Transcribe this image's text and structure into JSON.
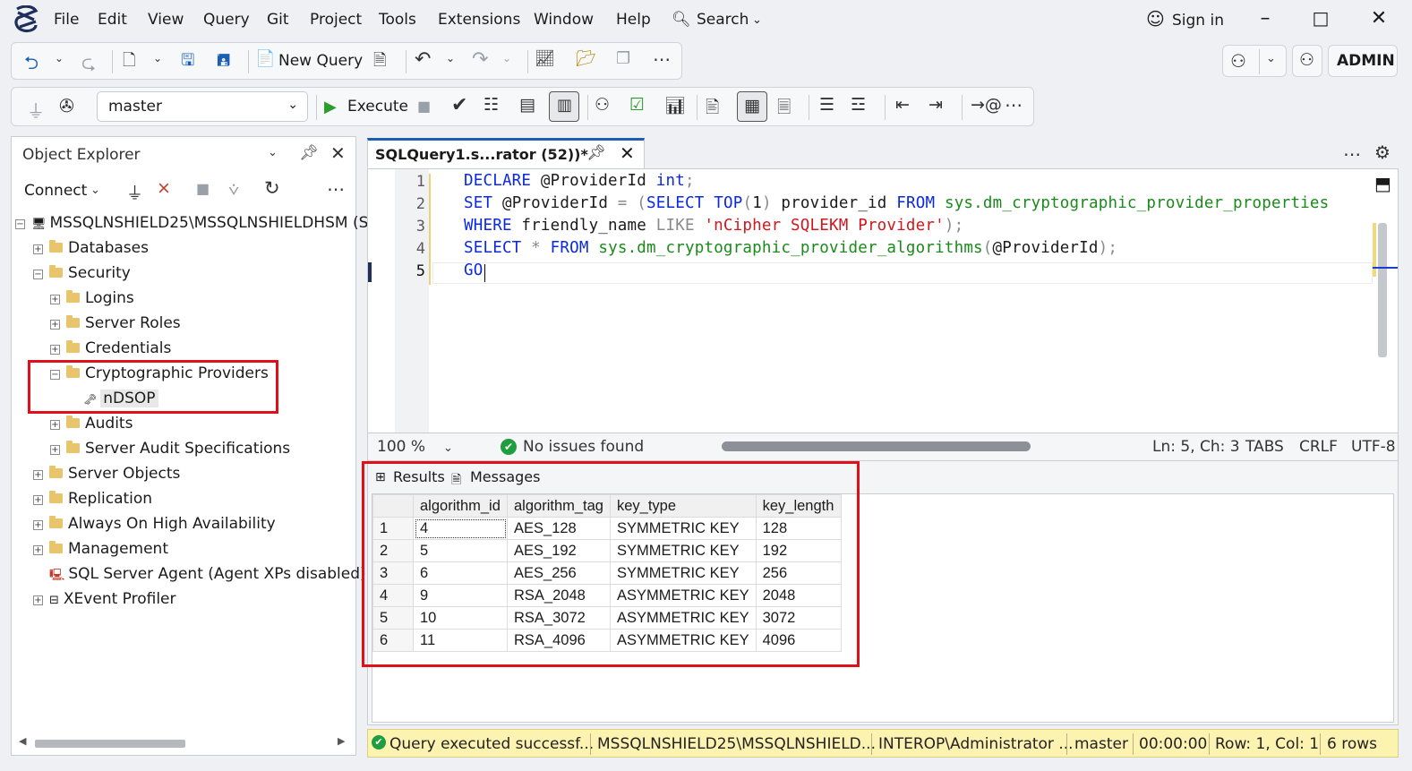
{
  "menu": {
    "items": [
      "File",
      "Edit",
      "View",
      "Query",
      "Git",
      "Project",
      "Tools",
      "Extensions",
      "Window",
      "Help"
    ],
    "search_label": "Search",
    "sign_in": "Sign in",
    "user": "ADMIN"
  },
  "toolbar": {
    "new_query": "New Query",
    "database": "master",
    "execute": "Execute"
  },
  "object_explorer": {
    "title": "Object Explorer",
    "connect": "Connect",
    "tree": [
      {
        "label": "MSSQLNSHIELD25\\MSSQLNSHIELDHSM (S",
        "expander": "−"
      },
      {
        "label": "Databases",
        "expander": "+"
      },
      {
        "label": "Security",
        "expander": "−"
      },
      {
        "label": "Logins",
        "expander": "+"
      },
      {
        "label": "Server Roles",
        "expander": "+"
      },
      {
        "label": "Credentials",
        "expander": "+"
      },
      {
        "label": "Cryptographic Providers",
        "expander": "−"
      },
      {
        "label": "nDSOP",
        "expander": ""
      },
      {
        "label": "Audits",
        "expander": "+"
      },
      {
        "label": "Server Audit Specifications",
        "expander": "+"
      },
      {
        "label": "Server Objects",
        "expander": "+"
      },
      {
        "label": "Replication",
        "expander": "+"
      },
      {
        "label": "Always On High Availability",
        "expander": "+"
      },
      {
        "label": "Management",
        "expander": "+"
      },
      {
        "label": "SQL Server Agent (Agent XPs disabled)",
        "expander": ""
      },
      {
        "label": "XEvent Profiler",
        "expander": "+"
      }
    ]
  },
  "editor": {
    "tab_title": "SQLQuery1.s...rator (52))*",
    "line_numbers": [
      "1",
      "2",
      "3",
      "4",
      "5"
    ],
    "lines": [
      [
        {
          "t": "DECLARE",
          "c": "kw"
        },
        {
          "t": " @ProviderId ",
          "c": ""
        },
        {
          "t": "int",
          "c": "kw"
        },
        {
          "t": ";",
          "c": "gry"
        }
      ],
      [
        {
          "t": "SET",
          "c": "kw"
        },
        {
          "t": " @ProviderId ",
          "c": ""
        },
        {
          "t": "=",
          "c": "gry"
        },
        {
          "t": " ",
          "c": ""
        },
        {
          "t": "(",
          "c": "gry"
        },
        {
          "t": "SELECT",
          "c": "kw"
        },
        {
          "t": " ",
          "c": ""
        },
        {
          "t": "TOP",
          "c": "kw"
        },
        {
          "t": "(",
          "c": "gry"
        },
        {
          "t": "1",
          "c": ""
        },
        {
          "t": ")",
          "c": "gry"
        },
        {
          "t": " provider_id ",
          "c": ""
        },
        {
          "t": "FROM",
          "c": "kw"
        },
        {
          "t": " sys.dm_cryptographic_provider_properties",
          "c": "sys"
        }
      ],
      [
        {
          "t": "WHERE",
          "c": "kw"
        },
        {
          "t": " friendly_name ",
          "c": ""
        },
        {
          "t": "LIKE",
          "c": "gry"
        },
        {
          "t": " ",
          "c": ""
        },
        {
          "t": "'nCipher SQLEKM Provider'",
          "c": "str"
        },
        {
          "t": ")",
          "c": "gry"
        },
        {
          "t": ";",
          "c": "gry"
        }
      ],
      [
        {
          "t": "SELECT",
          "c": "kw"
        },
        {
          "t": " ",
          "c": ""
        },
        {
          "t": "*",
          "c": "gry"
        },
        {
          "t": " ",
          "c": ""
        },
        {
          "t": "FROM",
          "c": "kw"
        },
        {
          "t": " sys.dm_cryptographic_provider_algorithms",
          "c": "sys"
        },
        {
          "t": "(",
          "c": "gry"
        },
        {
          "t": "@ProviderId",
          "c": ""
        },
        {
          "t": ")",
          "c": "gry"
        },
        {
          "t": ";",
          "c": "gry"
        }
      ],
      [
        {
          "t": "GO",
          "c": "kw"
        }
      ]
    ],
    "zoom": "100 %",
    "issues": "No issues found",
    "position": "Ln: 5, Ch: 3",
    "indent": "TABS",
    "line_ending": "CRLF",
    "encoding": "UTF-8"
  },
  "results": {
    "tabs": [
      "Results",
      "Messages"
    ],
    "columns": [
      "algorithm_id",
      "algorithm_tag",
      "key_type",
      "key_length"
    ],
    "rows": [
      [
        "1",
        "4",
        "AES_128",
        "SYMMETRIC KEY",
        "128"
      ],
      [
        "2",
        "5",
        "AES_192",
        "SYMMETRIC KEY",
        "192"
      ],
      [
        "3",
        "6",
        "AES_256",
        "SYMMETRIC KEY",
        "256"
      ],
      [
        "4",
        "9",
        "RSA_2048",
        "ASYMMETRIC KEY",
        "2048"
      ],
      [
        "5",
        "10",
        "RSA_3072",
        "ASYMMETRIC KEY",
        "3072"
      ],
      [
        "6",
        "11",
        "RSA_4096",
        "ASYMMETRIC KEY",
        "4096"
      ]
    ]
  },
  "status_bar": {
    "message": "Query  executed  successf...",
    "server": "MSSQLNSHIELD25\\MSSQLNSHIELD...",
    "user": "INTEROP\\Administrator ...",
    "database": "master",
    "elapsed": "00:00:00",
    "cursor": "Row: 1, Col: 1",
    "rows": "6 rows"
  },
  "colors": {
    "accent": "#1a5fb4",
    "highlight_box": "#e0101a",
    "status_bar": "#fdf3b0",
    "keyword": "#0a29e0",
    "system_object": "#1a8a1a",
    "string": "#d4151b"
  }
}
